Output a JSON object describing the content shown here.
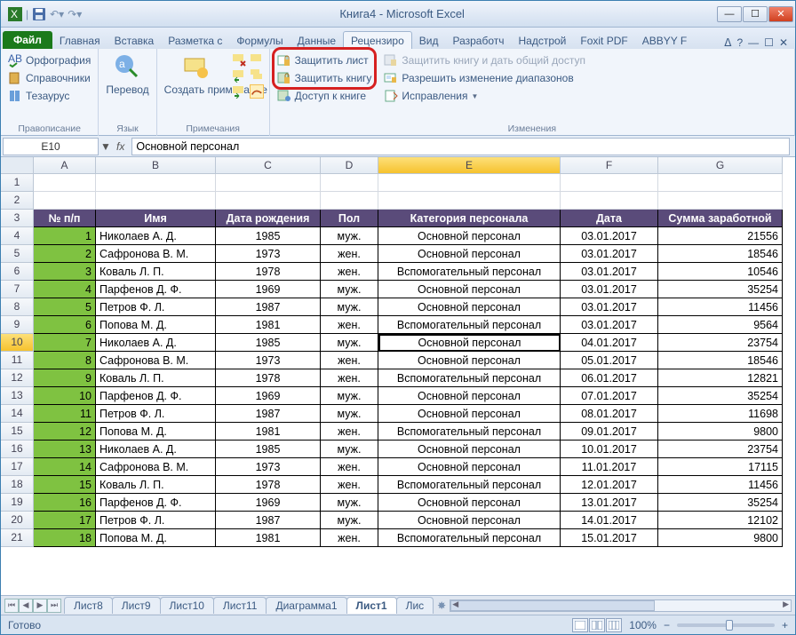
{
  "title": "Книга4 - Microsoft Excel",
  "qat": {
    "save": "💾"
  },
  "win": {
    "min": "—",
    "max": "☐",
    "close": "✕",
    "min2": "—",
    "max2": "☐",
    "close2": "✕"
  },
  "tabs": {
    "file": "Файл",
    "home": "Главная",
    "insert": "Вставка",
    "layout": "Разметка с",
    "formulas": "Формулы",
    "data": "Данные",
    "review": "Рецензиро",
    "view": "Вид",
    "dev": "Разработч",
    "addins": "Надстрой",
    "foxit": "Foxit PDF",
    "abbyy": "ABBYY F"
  },
  "ribbon": {
    "spelling": "Орфография",
    "reference": "Справочники",
    "thesaurus": "Тезаурус",
    "group1": "Правописание",
    "translate": "Перевод",
    "group2": "Язык",
    "newcomment": "Создать примечание",
    "group3": "Примечания",
    "protectSheet": "Защитить лист",
    "protectBook": "Защитить книгу",
    "shareBook": "Доступ к книге",
    "protectShare": "Защитить книгу и дать общий доступ",
    "allowRanges": "Разрешить изменение диапазонов",
    "trackChanges": "Исправления",
    "group4": "Изменения"
  },
  "namebox": "E10",
  "formula": "Основной персонал",
  "colHeaders": [
    "A",
    "B",
    "C",
    "D",
    "E",
    "F",
    "G"
  ],
  "tableHead": [
    "№ п/п",
    "Имя",
    "Дата рождения",
    "Пол",
    "Категория персонала",
    "Дата",
    "Сумма заработной"
  ],
  "rows": [
    {
      "r": 4,
      "n": 1,
      "name": "Николаев А. Д.",
      "birth": "1985",
      "sex": "муж.",
      "cat": "Основной персонал",
      "date": "03.01.2017",
      "sum": "21556"
    },
    {
      "r": 5,
      "n": 2,
      "name": "Сафронова В. М.",
      "birth": "1973",
      "sex": "жен.",
      "cat": "Основной персонал",
      "date": "03.01.2017",
      "sum": "18546"
    },
    {
      "r": 6,
      "n": 3,
      "name": "Коваль Л. П.",
      "birth": "1978",
      "sex": "жен.",
      "cat": "Вспомогательный персонал",
      "date": "03.01.2017",
      "sum": "10546"
    },
    {
      "r": 7,
      "n": 4,
      "name": "Парфенов Д. Ф.",
      "birth": "1969",
      "sex": "муж.",
      "cat": "Основной персонал",
      "date": "03.01.2017",
      "sum": "35254"
    },
    {
      "r": 8,
      "n": 5,
      "name": "Петров Ф. Л.",
      "birth": "1987",
      "sex": "муж.",
      "cat": "Основной персонал",
      "date": "03.01.2017",
      "sum": "11456"
    },
    {
      "r": 9,
      "n": 6,
      "name": "Попова М. Д.",
      "birth": "1981",
      "sex": "жен.",
      "cat": "Вспомогательный персонал",
      "date": "03.01.2017",
      "sum": "9564"
    },
    {
      "r": 10,
      "n": 7,
      "name": "Николаев А. Д.",
      "birth": "1985",
      "sex": "муж.",
      "cat": "Основной персонал",
      "date": "04.01.2017",
      "sum": "23754"
    },
    {
      "r": 11,
      "n": 8,
      "name": "Сафронова В. М.",
      "birth": "1973",
      "sex": "жен.",
      "cat": "Основной персонал",
      "date": "05.01.2017",
      "sum": "18546"
    },
    {
      "r": 12,
      "n": 9,
      "name": "Коваль Л. П.",
      "birth": "1978",
      "sex": "жен.",
      "cat": "Вспомогательный персонал",
      "date": "06.01.2017",
      "sum": "12821"
    },
    {
      "r": 13,
      "n": 10,
      "name": "Парфенов Д. Ф.",
      "birth": "1969",
      "sex": "муж.",
      "cat": "Основной персонал",
      "date": "07.01.2017",
      "sum": "35254"
    },
    {
      "r": 14,
      "n": 11,
      "name": "Петров Ф. Л.",
      "birth": "1987",
      "sex": "муж.",
      "cat": "Основной персонал",
      "date": "08.01.2017",
      "sum": "11698"
    },
    {
      "r": 15,
      "n": 12,
      "name": "Попова М. Д.",
      "birth": "1981",
      "sex": "жен.",
      "cat": "Вспомогательный персонал",
      "date": "09.01.2017",
      "sum": "9800"
    },
    {
      "r": 16,
      "n": 13,
      "name": "Николаев А. Д.",
      "birth": "1985",
      "sex": "муж.",
      "cat": "Основной персонал",
      "date": "10.01.2017",
      "sum": "23754"
    },
    {
      "r": 17,
      "n": 14,
      "name": "Сафронова В. М.",
      "birth": "1973",
      "sex": "жен.",
      "cat": "Основной персонал",
      "date": "11.01.2017",
      "sum": "17115"
    },
    {
      "r": 18,
      "n": 15,
      "name": "Коваль Л. П.",
      "birth": "1978",
      "sex": "жен.",
      "cat": "Вспомогательный персонал",
      "date": "12.01.2017",
      "sum": "11456"
    },
    {
      "r": 19,
      "n": 16,
      "name": "Парфенов Д. Ф.",
      "birth": "1969",
      "sex": "муж.",
      "cat": "Основной персонал",
      "date": "13.01.2017",
      "sum": "35254"
    },
    {
      "r": 20,
      "n": 17,
      "name": "Петров Ф. Л.",
      "birth": "1987",
      "sex": "муж.",
      "cat": "Основной персонал",
      "date": "14.01.2017",
      "sum": "12102"
    },
    {
      "r": 21,
      "n": 18,
      "name": "Попова М. Д.",
      "birth": "1981",
      "sex": "жен.",
      "cat": "Вспомогательный персонал",
      "date": "15.01.2017",
      "sum": "9800"
    }
  ],
  "sheets": [
    "Лист8",
    "Лист9",
    "Лист10",
    "Лист11",
    "Диаграмма1",
    "Лист1",
    "Лис"
  ],
  "activeSheet": "Лист1",
  "status": "Готово",
  "zoom": "100%"
}
